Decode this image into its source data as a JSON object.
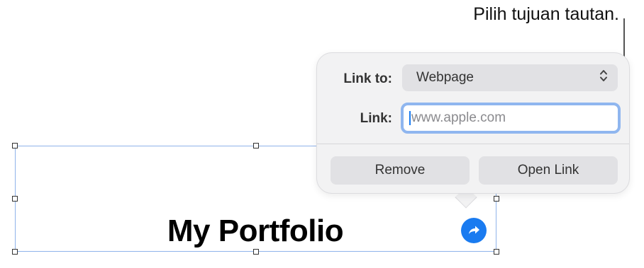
{
  "callout": {
    "text": "Pilih tujuan tautan."
  },
  "popover": {
    "link_to_label": "Link to:",
    "link_to_value": "Webpage",
    "link_label": "Link:",
    "link_placeholder": "www.apple.com",
    "link_value": "",
    "remove_label": "Remove",
    "open_link_label": "Open Link"
  },
  "canvas": {
    "title_text": "My Portfolio"
  },
  "colors": {
    "accent": "#1a7bf0",
    "focus_ring": "#8fb6ef",
    "selection": "#8fb3ea"
  }
}
